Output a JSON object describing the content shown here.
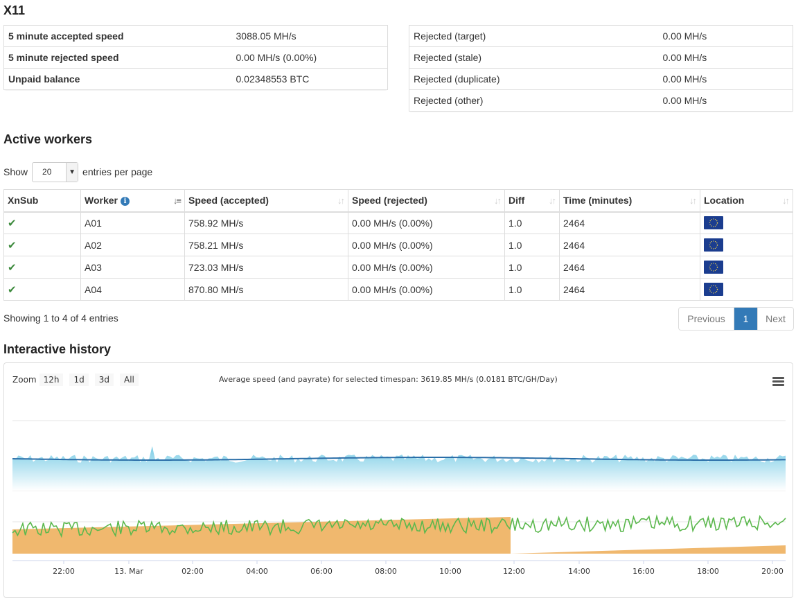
{
  "algorithm": "X11",
  "summary_left": [
    {
      "label": "5 minute accepted speed",
      "value": "3088.05 MH/s"
    },
    {
      "label": "5 minute rejected speed",
      "value": "0.00 MH/s (0.00%)"
    },
    {
      "label": "Unpaid balance",
      "value": "0.02348553 BTC"
    }
  ],
  "summary_right": [
    {
      "label": "Rejected (target)",
      "value": "0.00 MH/s"
    },
    {
      "label": "Rejected (stale)",
      "value": "0.00 MH/s"
    },
    {
      "label": "Rejected (duplicate)",
      "value": "0.00 MH/s"
    },
    {
      "label": "Rejected (other)",
      "value": "0.00 MH/s"
    }
  ],
  "workers_section": {
    "title": "Active workers",
    "show_label": "Show",
    "per_page_value": "20",
    "per_page_suffix": "entries per page",
    "columns": [
      "XnSub",
      "Worker",
      "Speed (accepted)",
      "Speed (rejected)",
      "Diff",
      "Time (minutes)",
      "Location"
    ],
    "rows": [
      {
        "xnsub": "✔",
        "worker": "A01",
        "accepted": "758.92 MH/s",
        "rejected": "0.00 MH/s (0.00%)",
        "diff": "1.0",
        "time": "2464",
        "location": "eu-flag-icon"
      },
      {
        "xnsub": "✔",
        "worker": "A02",
        "accepted": "758.21 MH/s",
        "rejected": "0.00 MH/s (0.00%)",
        "diff": "1.0",
        "time": "2464",
        "location": "eu-flag-icon"
      },
      {
        "xnsub": "✔",
        "worker": "A03",
        "accepted": "723.03 MH/s",
        "rejected": "0.00 MH/s (0.00%)",
        "diff": "1.0",
        "time": "2464",
        "location": "eu-flag-icon"
      },
      {
        "xnsub": "✔",
        "worker": "A04",
        "accepted": "870.80 MH/s",
        "rejected": "0.00 MH/s (0.00%)",
        "diff": "1.0",
        "time": "2464",
        "location": "eu-flag-icon"
      }
    ],
    "showing_text": "Showing 1 to 4 of 4 entries",
    "pagination": {
      "previous": "Previous",
      "current": "1",
      "next": "Next"
    }
  },
  "history": {
    "title": "Interactive history",
    "zoom_label": "Zoom",
    "zoom_buttons": [
      "12h",
      "1d",
      "3d",
      "All"
    ],
    "average_text": "Average speed (and payrate) for selected timespan: 3619.85 MH/s (0.0181 BTC/GH/Day)",
    "menu_icon": "hamburger-menu-icon",
    "colors": {
      "speed_fill": "#7ccde6",
      "speed_line": "#2b6ea8",
      "payrate_line": "#5bb84d",
      "unpaid_fill": "#f0b86e"
    }
  },
  "chart_data": {
    "type": "area",
    "x_ticks": [
      "22:00",
      "13. Mar",
      "02:00",
      "04:00",
      "06:00",
      "08:00",
      "10:00",
      "12:00",
      "14:00",
      "16:00",
      "18:00",
      "20:00"
    ],
    "grid": true,
    "series": []
  }
}
